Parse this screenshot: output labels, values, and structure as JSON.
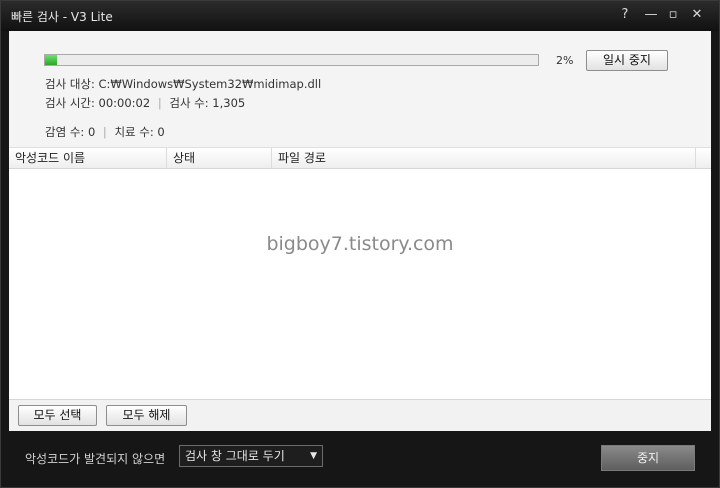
{
  "window": {
    "title": "빠른 검사 - V3 Lite",
    "help": "?",
    "minimize": "—",
    "maximize": "▫",
    "close": "✕"
  },
  "scan": {
    "progress_percent": 2,
    "progress_label": "2%",
    "pause_label": "일시 중지",
    "target_label": "검사 대상:",
    "target_value": "C:₩Windows₩System32₩midimap.dll",
    "time_label": "검사 시간:",
    "time_value": "00:00:02",
    "count_label": "검사 수:",
    "count_value": "1,305",
    "infected_label": "감염 수:",
    "infected_value": "0",
    "cured_label": "치료 수:",
    "cured_value": "0"
  },
  "table": {
    "columns": [
      "악성코드 이름",
      "상태",
      "파일 경로"
    ],
    "rows": []
  },
  "watermark": "bigboy7.tistory.com",
  "list_actions": {
    "select_all": "모두 선택",
    "deselect_all": "모두 해제"
  },
  "footer": {
    "condition_text": "악성코드가 발견되지 않으면",
    "select_value": "검사 창 그대로 두기",
    "stop_label": "중지"
  },
  "colors": {
    "progress_fill": "#2aa52a",
    "frame": "#161616"
  }
}
